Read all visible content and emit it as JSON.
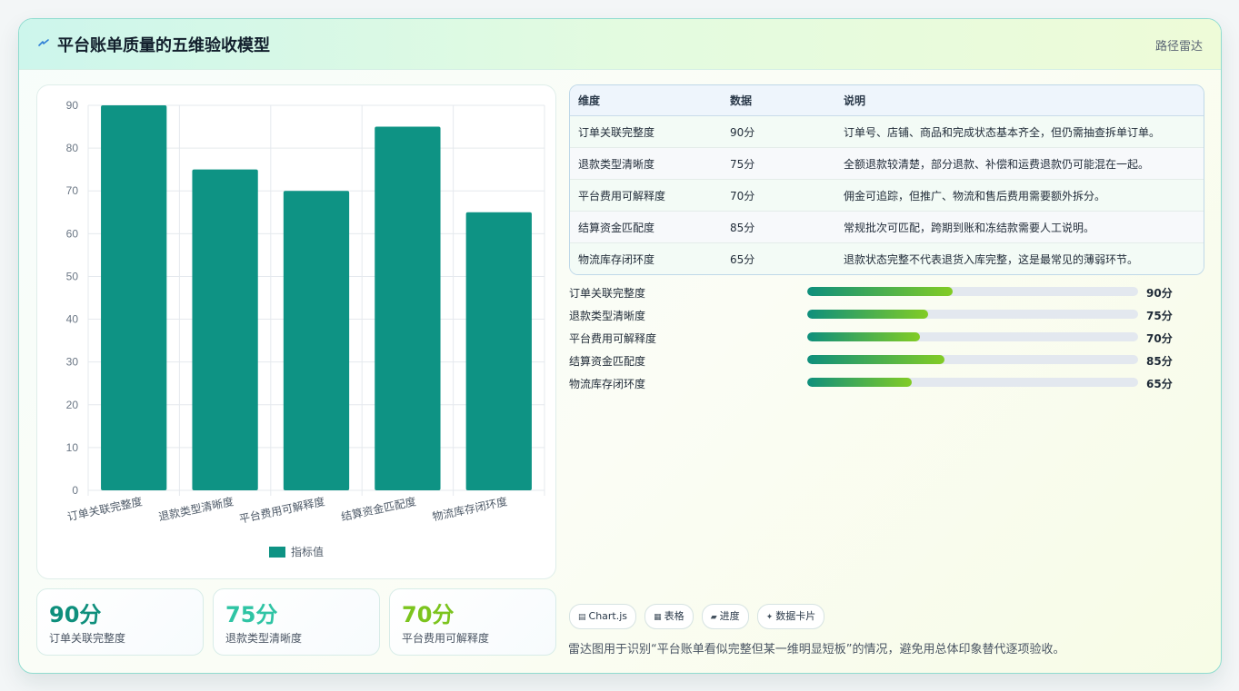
{
  "header": {
    "icon": "lightning-icon",
    "title": "平台账单质量的五维验收模型",
    "tag": "路径雷达"
  },
  "chart_data": {
    "type": "bar",
    "categories": [
      "订单关联完整度",
      "退款类型清晰度",
      "平台费用可解释度",
      "结算资金匹配度",
      "物流库存闭环度"
    ],
    "series": [
      {
        "name": "指标值",
        "values": [
          90,
          75,
          70,
          85,
          65
        ],
        "color": "#0e9384"
      }
    ],
    "ylim": [
      0,
      90
    ],
    "yticks": [
      0,
      10,
      20,
      30,
      40,
      50,
      60,
      70,
      80,
      90
    ],
    "grid": true,
    "legend": "bottom"
  },
  "kpis": [
    {
      "value": "90分",
      "label": "订单关联完整度",
      "color": "#0e8f7c"
    },
    {
      "value": "75分",
      "label": "退款类型清晰度",
      "color": "#2fc4a4"
    },
    {
      "value": "70分",
      "label": "平台费用可解释度",
      "color": "#7cc41e"
    }
  ],
  "table": {
    "headers": [
      "维度",
      "数据",
      "说明"
    ],
    "rows": [
      [
        "订单关联完整度",
        "90分",
        "订单号、店铺、商品和完成状态基本齐全，但仍需抽查拆单订单。"
      ],
      [
        "退款类型清晰度",
        "75分",
        "全额退款较清楚，部分退款、补偿和运费退款仍可能混在一起。"
      ],
      [
        "平台费用可解释度",
        "70分",
        "佣金可追踪，但推广、物流和售后费用需要额外拆分。"
      ],
      [
        "结算资金匹配度",
        "85分",
        "常规批次可匹配，跨期到账和冻结款需要人工说明。"
      ],
      [
        "物流库存闭环度",
        "65分",
        "退款状态完整不代表退货入库完整，这是最常见的薄弱环节。"
      ]
    ]
  },
  "progress": [
    {
      "label": "订单关联完整度",
      "value": "90分",
      "fill": 0.44
    },
    {
      "label": "退款类型清晰度",
      "value": "75分",
      "fill": 0.365
    },
    {
      "label": "平台费用可解释度",
      "value": "70分",
      "fill": 0.34
    },
    {
      "label": "结算资金匹配度",
      "value": "85分",
      "fill": 0.415
    },
    {
      "label": "物流库存闭环度",
      "value": "65分",
      "fill": 0.315
    }
  ],
  "chips": [
    {
      "icon": "table-icon",
      "glyph": "▤",
      "label": "Chart.js"
    },
    {
      "icon": "grid-icon",
      "glyph": "▦",
      "label": "表格"
    },
    {
      "icon": "progress-icon",
      "glyph": "▰",
      "label": "进度"
    },
    {
      "icon": "sparkle-icon",
      "glyph": "✦",
      "label": "数据卡片"
    }
  ],
  "note": "雷达图用于识别“平台账单看似完整但某一维明显短板”的情况，避免用总体印象替代逐项验收。"
}
